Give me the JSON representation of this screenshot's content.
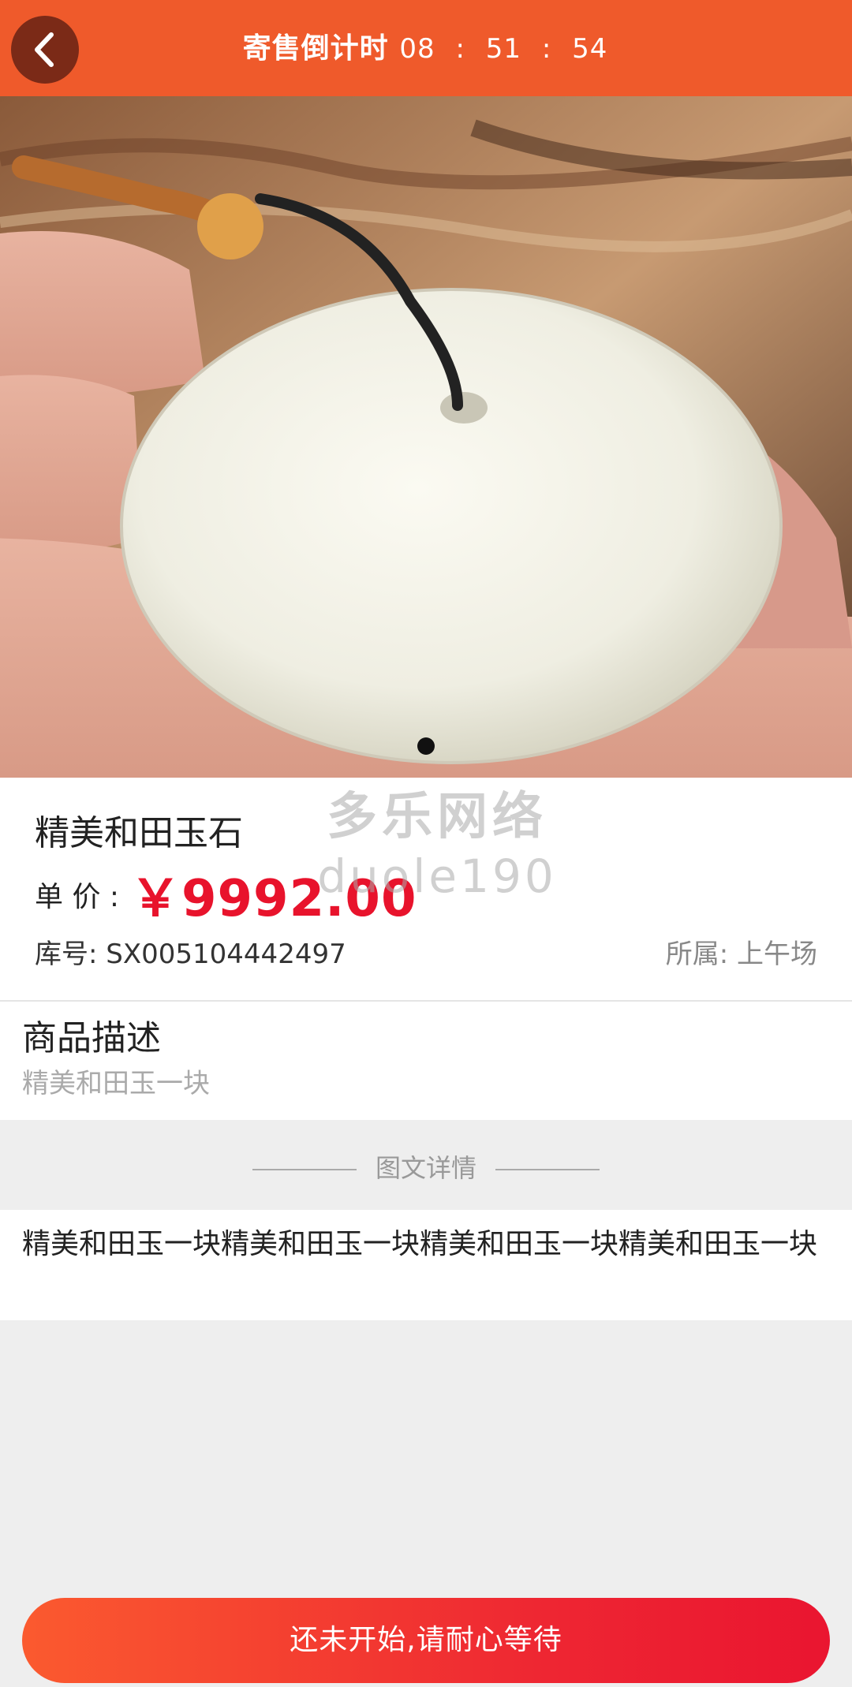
{
  "header": {
    "back_icon": "chevron-left-icon",
    "countdown_label": "寄售倒计时",
    "countdown": {
      "hours": "08",
      "minutes": "51",
      "seconds": "54"
    },
    "separator": ":",
    "bg_color": "#ef5a2b"
  },
  "gallery": {
    "image_description_icon": "jade-pendant-photo",
    "page_indicator_count": 1
  },
  "product": {
    "name": "精美和田玉石",
    "price_label": "单 价 :",
    "price": "￥9992.00",
    "stock_label": "库号: SX005104442497",
    "belong_label": "所属: 上午场",
    "price_color": "#e8132c"
  },
  "watermark": {
    "line1": "多乐网络",
    "line2": "duole190"
  },
  "description": {
    "title": "商品描述",
    "text": "精美和田玉一块"
  },
  "detail": {
    "section_title": "图文详情",
    "text": "精美和田玉一块精美和田玉一块精美和田玉一块精美和田玉一块"
  },
  "cta": {
    "label": "还未开始,请耐心等待"
  }
}
